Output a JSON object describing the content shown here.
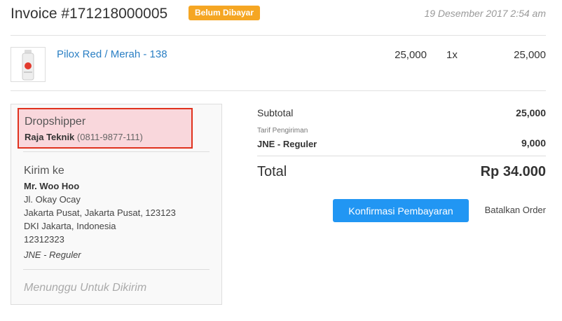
{
  "invoice": {
    "title": "Invoice #171218000005",
    "status_badge": "Belum Dibayar",
    "date": "19 Desember 2017 2:54 am"
  },
  "product": {
    "name": "Pilox Red / Merah - 138",
    "price": "25,000",
    "qty": "1x",
    "total": "25,000",
    "thumbnail_icon": "spray-can-icon"
  },
  "dropshipper": {
    "title": "Dropshipper",
    "name": "Raja Teknik",
    "phone": "(0811-9877-111)"
  },
  "shipping": {
    "title": "Kirim ke",
    "recipient": "Mr. Woo Hoo",
    "address_lines": [
      "Jl. Okay Ocay",
      "Jakarta Pusat, Jakarta Pusat, 123123",
      "DKI Jakarta, Indonesia",
      "12312323"
    ],
    "courier": "JNE - Reguler",
    "status": "Menunggu Untuk Dikirim"
  },
  "summary": {
    "subtotal_label": "Subtotal",
    "subtotal_value": "25,000",
    "shipping_fee_label": "Tarif Pengiriman",
    "shipping_service": "JNE - Reguler",
    "shipping_value": "9,000",
    "total_label": "Total",
    "total_value": "Rp 34.000"
  },
  "actions": {
    "confirm_label": "Konfirmasi Pembayaran",
    "cancel_label": "Batalkan Order"
  },
  "colors": {
    "badge": "#f5a623",
    "link": "#2a7fc4",
    "primary_button": "#2196f3",
    "highlight_border": "#e0321e",
    "highlight_fill": "#f9d7dc"
  }
}
